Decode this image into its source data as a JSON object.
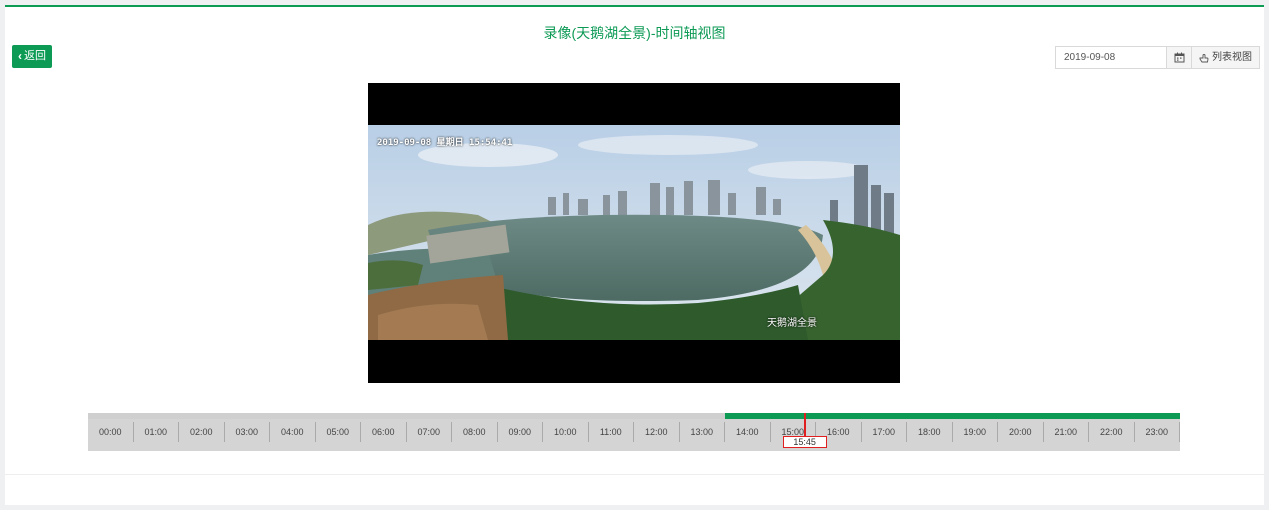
{
  "header": {
    "title": "录像(天鹅湖全景)-时间轴视图",
    "back_label": "返回"
  },
  "toolbar": {
    "date_value": "2019-09-08",
    "list_view_label": "列表视图"
  },
  "video": {
    "osd_timestamp": "2019-09-08 星期日 15:54:41",
    "osd_camera_name": "天鹅湖全景"
  },
  "timeline": {
    "hours": [
      "00:00",
      "01:00",
      "02:00",
      "03:00",
      "04:00",
      "05:00",
      "06:00",
      "07:00",
      "08:00",
      "09:00",
      "10:00",
      "11:00",
      "12:00",
      "13:00",
      "14:00",
      "15:00",
      "16:00",
      "17:00",
      "18:00",
      "19:00",
      "20:00",
      "21:00",
      "22:00",
      "23:00"
    ],
    "record_start_hour": 14.0,
    "record_end_hour": 24.0,
    "cursor_hour": 15.75,
    "cursor_label": "15:45"
  },
  "colors": {
    "accent": "#0c9a55",
    "cursor": "#e02020"
  }
}
